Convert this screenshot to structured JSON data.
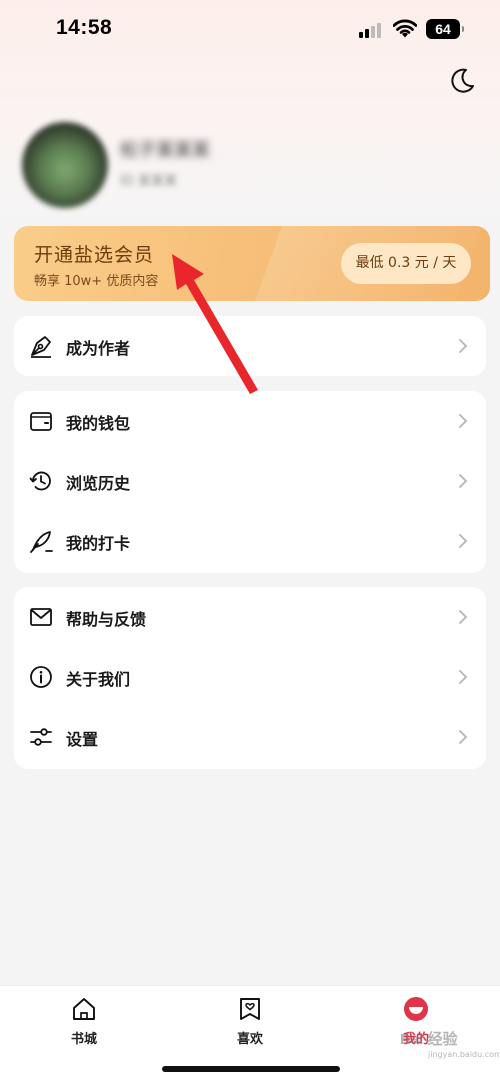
{
  "status_bar": {
    "time": "14:58",
    "battery": "64"
  },
  "profile": {
    "name": "松子某某某",
    "user_id": "ID 某某某"
  },
  "vip": {
    "title": "开通盐选会员",
    "subtitle": "畅享 10w+ 优质内容",
    "price": "最低 0.3 元 / 天"
  },
  "menu": {
    "group1": [
      {
        "label": "成为作者",
        "icon": "pen-nib-icon"
      }
    ],
    "group2": [
      {
        "label": "我的钱包",
        "icon": "wallet-icon"
      },
      {
        "label": "浏览历史",
        "icon": "history-icon"
      },
      {
        "label": "我的打卡",
        "icon": "feather-icon"
      }
    ],
    "group3": [
      {
        "label": "帮助与反馈",
        "icon": "mail-icon"
      },
      {
        "label": "关于我们",
        "icon": "info-icon"
      },
      {
        "label": "设置",
        "icon": "sliders-icon"
      }
    ]
  },
  "tabs": [
    {
      "label": "书城",
      "icon": "home-icon",
      "active": false
    },
    {
      "label": "喜欢",
      "icon": "bookmark-heart-icon",
      "active": false
    },
    {
      "label": "我的",
      "icon": "profile-icon",
      "active": true
    }
  ],
  "colors": {
    "accent": "#e0344a",
    "vip_gradient_start": "#f9cd8a",
    "vip_text": "#6b3d0f",
    "annotation": "#e8262c"
  },
  "watermark": {
    "text": "Bai 经验",
    "sub": "jingyan.baidu.com"
  }
}
